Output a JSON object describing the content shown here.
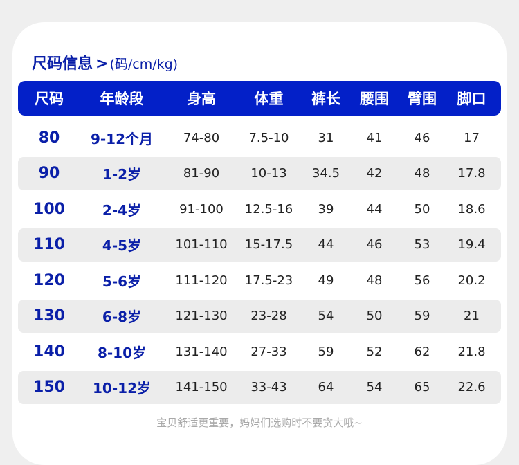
{
  "heading": {
    "title": "尺码信息",
    "arrow": ">",
    "unit": "(码/cm/kg)"
  },
  "table": {
    "columns": [
      "尺码",
      "年龄段",
      "身高",
      "体重",
      "裤长",
      "腰围",
      "臂围",
      "脚口"
    ],
    "rows": [
      [
        "80",
        "9-12个月",
        "74-80",
        "7.5-10",
        "31",
        "41",
        "46",
        "17"
      ],
      [
        "90",
        "1-2岁",
        "81-90",
        "10-13",
        "34.5",
        "42",
        "48",
        "17.8"
      ],
      [
        "100",
        "2-4岁",
        "91-100",
        "12.5-16",
        "39",
        "44",
        "50",
        "18.6"
      ],
      [
        "110",
        "4-5岁",
        "101-110",
        "15-17.5",
        "44",
        "46",
        "53",
        "19.4"
      ],
      [
        "120",
        "5-6岁",
        "111-120",
        "17.5-23",
        "49",
        "48",
        "56",
        "20.2"
      ],
      [
        "130",
        "6-8岁",
        "121-130",
        "23-28",
        "54",
        "50",
        "59",
        "21"
      ],
      [
        "140",
        "8-10岁",
        "131-140",
        "27-33",
        "59",
        "52",
        "62",
        "21.8"
      ],
      [
        "150",
        "10-12岁",
        "141-150",
        "33-43",
        "64",
        "54",
        "65",
        "22.6"
      ]
    ]
  },
  "footer": {
    "note": "宝贝舒适更重要，妈妈们选购时不要贪大哦~"
  },
  "colors": {
    "header_bg": "#0320c8",
    "accent_text": "#0a1fa8",
    "row_shade": "#ececec"
  }
}
